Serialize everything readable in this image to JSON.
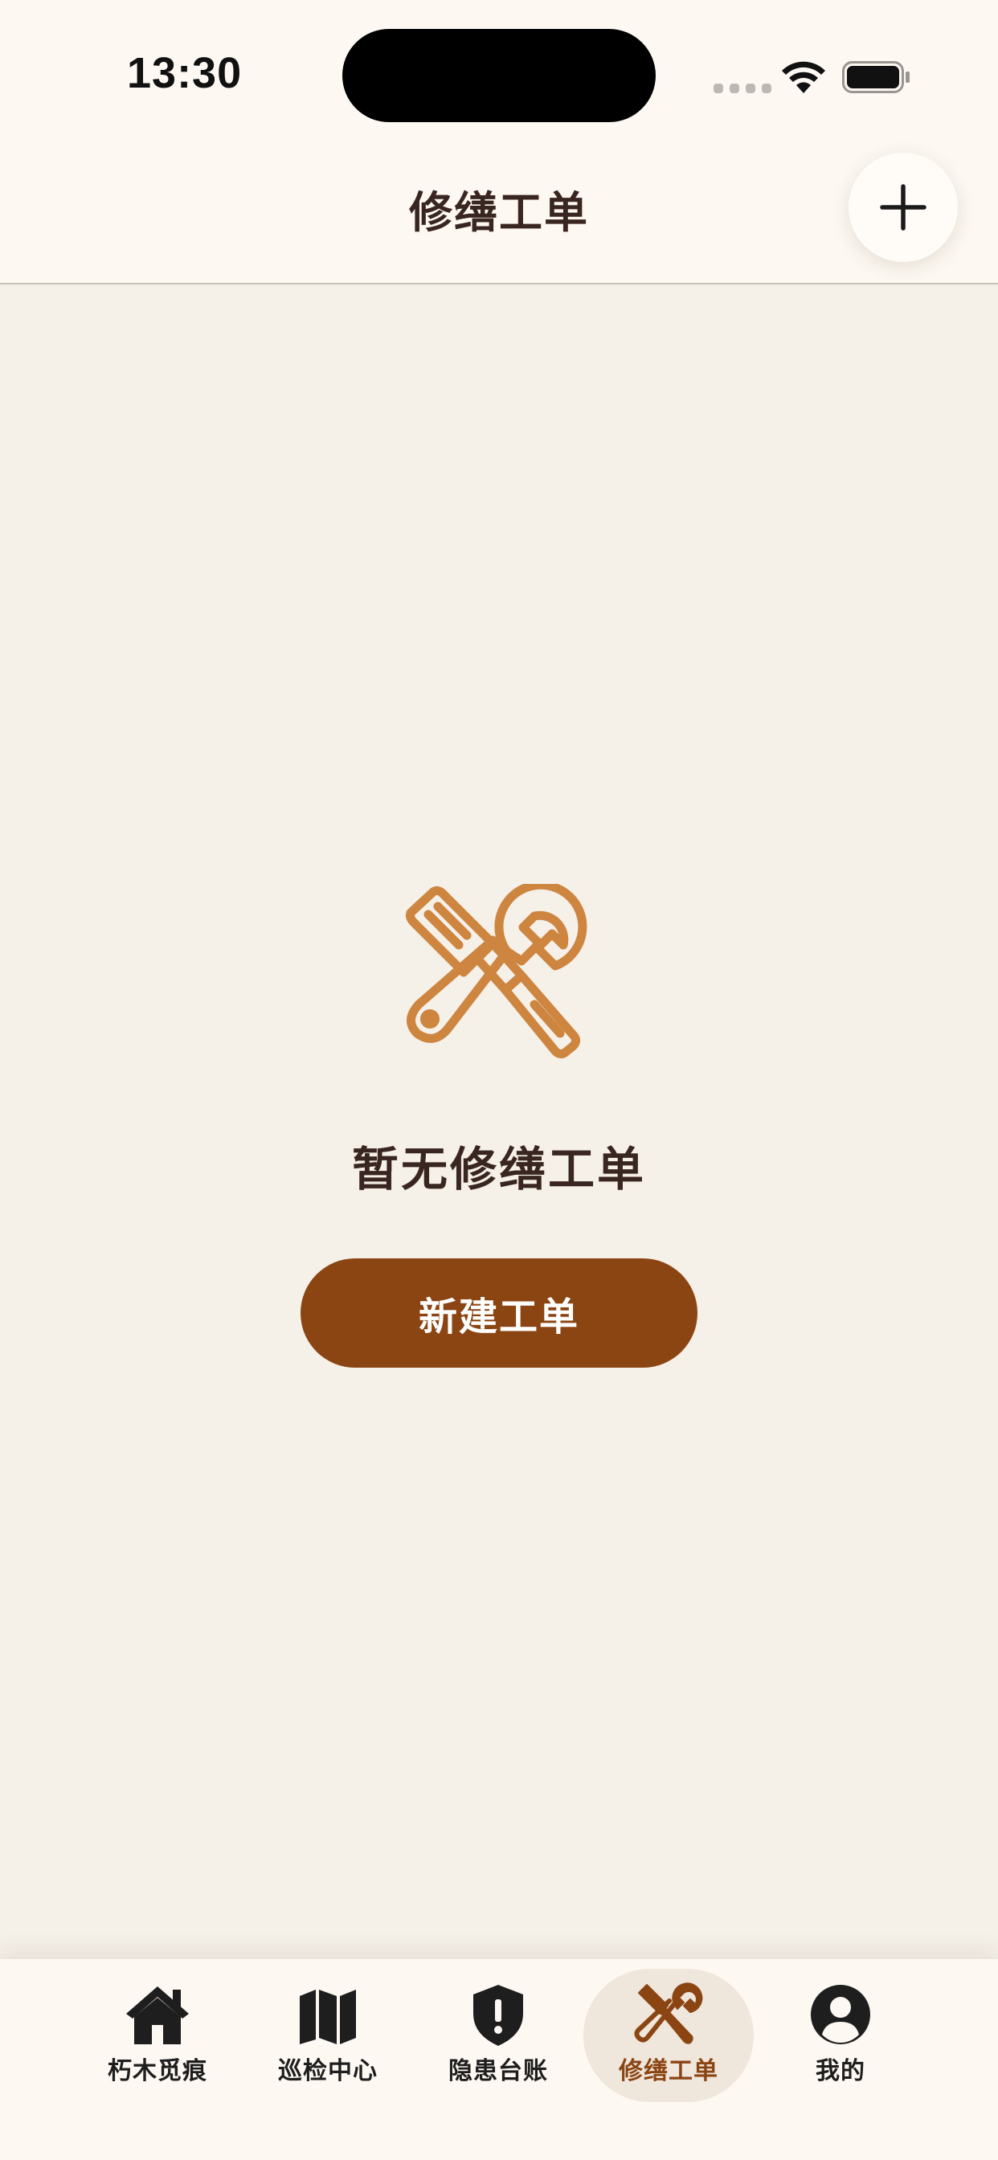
{
  "status_bar": {
    "time": "13:30"
  },
  "header": {
    "title": "修缮工单",
    "add_icon": "plus-icon"
  },
  "empty_state": {
    "icon": "wrench-screwdriver-icon",
    "message": "暂无修缮工单",
    "button_label": "新建工单"
  },
  "tab_bar": {
    "items": [
      {
        "label": "朽木觅痕",
        "icon": "house-icon",
        "active": false
      },
      {
        "label": "巡检中心",
        "icon": "map-icon",
        "active": false
      },
      {
        "label": "隐患台账",
        "icon": "shield-alert-icon",
        "active": false
      },
      {
        "label": "修缮工单",
        "icon": "tools-icon",
        "active": true
      },
      {
        "label": "我的",
        "icon": "user-circle-icon",
        "active": false
      }
    ]
  },
  "colors": {
    "background": "#F5F0E8",
    "header_background": "#FDF8F2",
    "accent": "#8B4513",
    "icon_accent": "#CD853F",
    "text_primary": "#3A2620",
    "tab_active_background": "#EFE6DC"
  }
}
